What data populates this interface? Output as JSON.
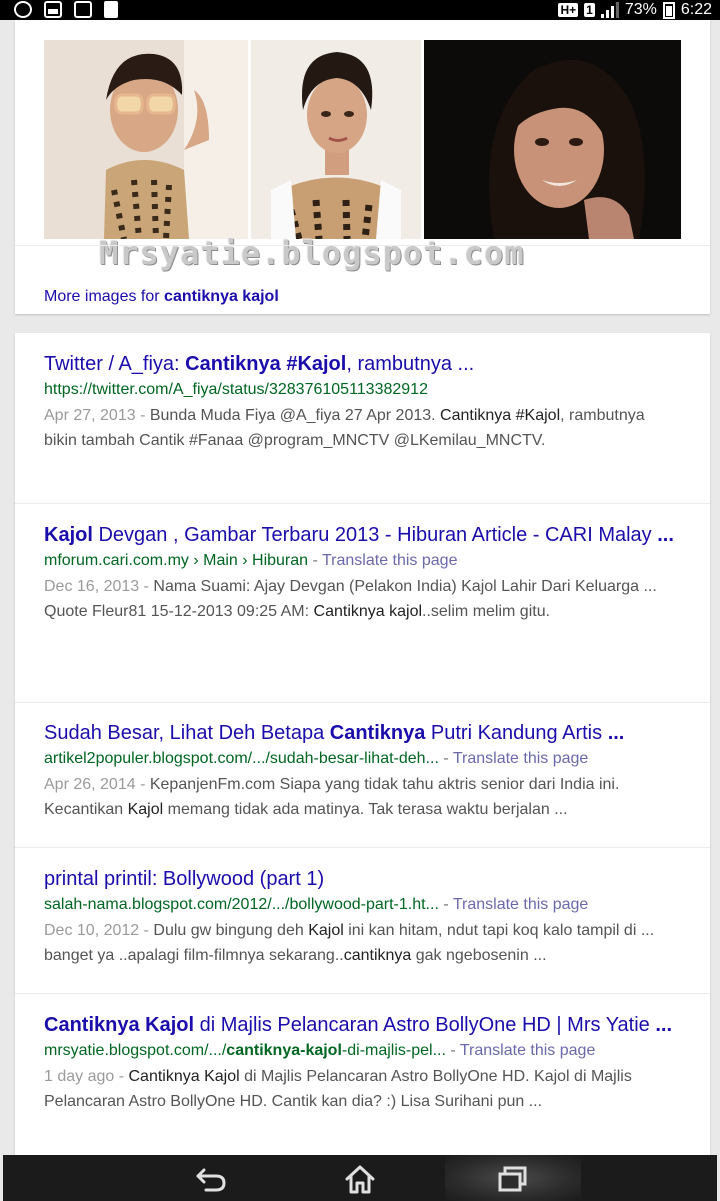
{
  "status_bar": {
    "left_icons": [
      "whatsapp-icon",
      "gallery-icon",
      "notes-icon",
      "document-icon"
    ],
    "network": "H+",
    "sim": "1",
    "battery": "73%",
    "time": "6:22"
  },
  "images_block": {
    "watermark": "Mrsyatie.blogspot.com",
    "more_prefix": "More images for ",
    "more_query": "cantiknya kajol"
  },
  "results": [
    {
      "title_parts": [
        {
          "t": "Twitter / A_fiya: ",
          "b": false
        },
        {
          "t": "Cantiknya #Kajol",
          "b": true
        },
        {
          "t": ", rambutnya ...",
          "b": false
        }
      ],
      "url": "https://twitter.com/A_fiya/status/328376105113382912",
      "translate": "",
      "date": "Apr 27, 2013 - ",
      "snippet_parts": [
        {
          "t": "Bunda Muda Fiya @A_fiya 27 Apr 2013. ",
          "b": false
        },
        {
          "t": "Cantiknya #Kajol",
          "b": true
        },
        {
          "t": ", rambutnya bikin tambah Cantik #Fanaa @program_MNCTV @LKemilau_MNCTV.",
          "b": false
        }
      ]
    },
    {
      "title_parts": [
        {
          "t": "Kajol",
          "b": true
        },
        {
          "t": " Devgan , Gambar Terbaru 2013 - Hiburan Article - CARI Malay ",
          "b": false
        },
        {
          "t": "...",
          "b": true
        }
      ],
      "url": "mforum.cari.com.my › Main › Hiburan",
      "translate": "Translate this page",
      "date": "Dec 16, 2013 - ",
      "snippet_parts": [
        {
          "t": "Nama Suami: Ajay Devgan (Pelakon India) Kajol Lahir Dari Keluarga ... Quote Fleur81 15-12-2013 09:25 AM: ",
          "b": false
        },
        {
          "t": "Cantiknya kajol",
          "b": true
        },
        {
          "t": "..selim melim gitu.",
          "b": false
        }
      ]
    },
    {
      "title_parts": [
        {
          "t": "Sudah Besar, Lihat Deh Betapa ",
          "b": false
        },
        {
          "t": "Cantiknya",
          "b": true
        },
        {
          "t": " Putri Kandung Artis ",
          "b": false
        },
        {
          "t": "...",
          "b": true
        }
      ],
      "url": "artikel2populer.blogspot.com/.../sudah-besar-lihat-deh...",
      "translate": "Translate this page",
      "date": "Apr 26, 2014 - ",
      "snippet_parts": [
        {
          "t": "KepanjenFm.com Siapa yang tidak tahu aktris senior dari India ini. Kecantikan ",
          "b": false
        },
        {
          "t": "Kajol",
          "b": true
        },
        {
          "t": " memang tidak ada matinya. Tak terasa waktu berjalan ...",
          "b": false
        }
      ]
    },
    {
      "title_parts": [
        {
          "t": "printal printil: Bollywood (part 1)",
          "b": false
        }
      ],
      "url": "salah-nama.blogspot.com/2012/.../bollywood-part-1.ht...",
      "translate": "Translate this page",
      "date": "Dec 10, 2012 - ",
      "snippet_parts": [
        {
          "t": "Dulu gw bingung deh ",
          "b": false
        },
        {
          "t": "Kajol",
          "b": true
        },
        {
          "t": " ini kan hitam, ndut tapi koq kalo tampil di ... banget ya ..apalagi film-filmnya sekarang..",
          "b": false
        },
        {
          "t": "cantiknya",
          "b": true
        },
        {
          "t": " gak ngebosenin ...",
          "b": false
        }
      ]
    },
    {
      "title_parts": [
        {
          "t": "Cantiknya Kajol",
          "b": true
        },
        {
          "t": " di Majlis Pelancaran Astro BollyOne HD | Mrs Yatie ",
          "b": false
        },
        {
          "t": "...",
          "b": true
        }
      ],
      "url_parts": [
        {
          "t": "mrsyatie.blogspot.com/.../",
          "b": false
        },
        {
          "t": "cantiknya-kajol",
          "b": true
        },
        {
          "t": "-di-majlis-pel...",
          "b": false
        }
      ],
      "translate": "Translate this page",
      "date": "1 day ago - ",
      "snippet_parts": [
        {
          "t": "Cantiknya Kajol",
          "b": true
        },
        {
          "t": " di Majlis Pelancaran Astro BollyOne HD. Kajol di Majlis Pelancaran Astro BollyOne HD. Cantik kan dia? :) Lisa Surihani pun ...",
          "b": false
        }
      ]
    }
  ],
  "navbar": {
    "buttons": [
      "back-icon",
      "home-icon",
      "recent-apps-icon"
    ]
  }
}
